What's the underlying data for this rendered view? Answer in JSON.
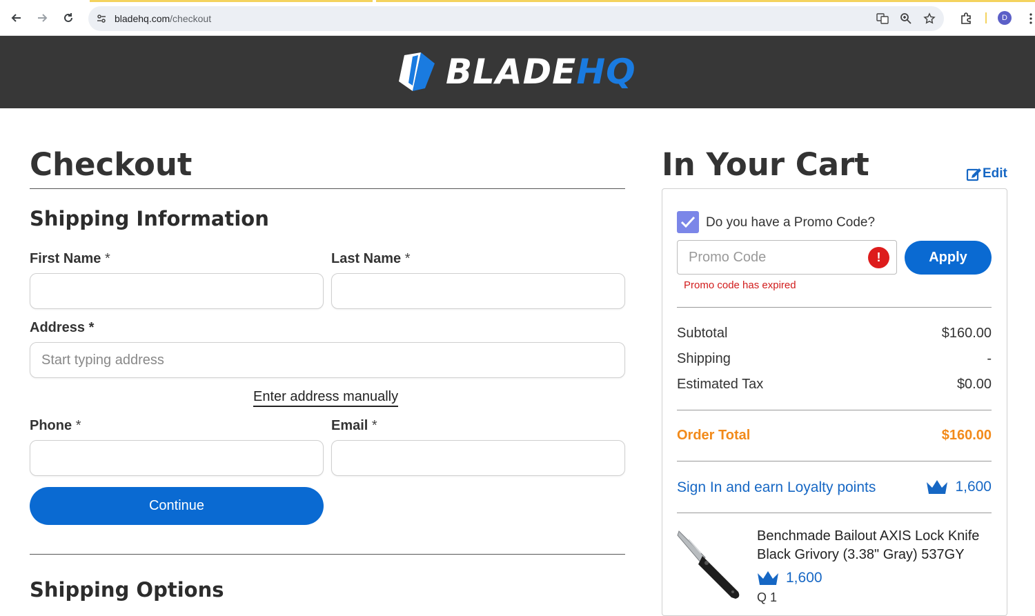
{
  "browser": {
    "url_domain": "bladehq.com",
    "url_path": "/checkout",
    "avatar_letter": "D"
  },
  "header": {
    "logo_blade": "BLADE",
    "logo_hq": "HQ"
  },
  "checkout": {
    "title": "Checkout",
    "shipping_section": "Shipping Information",
    "first_name_label": "First Name",
    "last_name_label": "Last Name",
    "address_label": "Address",
    "address_placeholder": "Start typing address",
    "manual_link": "Enter address manually",
    "phone_label": "Phone",
    "email_label": "Email",
    "required_marker": "*",
    "continue_label": "Continue",
    "shipping_options": "Shipping Options"
  },
  "cart": {
    "title": "In Your Cart",
    "edit_label": "Edit",
    "promo_question": "Do you have a Promo Code?",
    "promo_placeholder": "Promo Code",
    "promo_error_icon": "!",
    "apply_label": "Apply",
    "promo_error": "Promo code has expired",
    "subtotal_label": "Subtotal",
    "subtotal_value": "$160.00",
    "shipping_label": "Shipping",
    "shipping_value": "-",
    "tax_label": "Estimated Tax",
    "tax_value": "$0.00",
    "order_total_label": "Order Total",
    "order_total_value": "$160.00",
    "loyalty_link": "Sign In and earn Loyalty points",
    "loyalty_points": "1,600",
    "product": {
      "name": "Benchmade Bailout AXIS Lock Knife Black Grivory (3.38\" Gray) 537GY",
      "points": "1,600",
      "qty_fragment": "Q   1"
    }
  },
  "colors": {
    "brand_blue": "#0a6ad2",
    "header_bg": "#373737",
    "total_orange": "#f28a1a",
    "error_red": "#dd1c1c"
  }
}
